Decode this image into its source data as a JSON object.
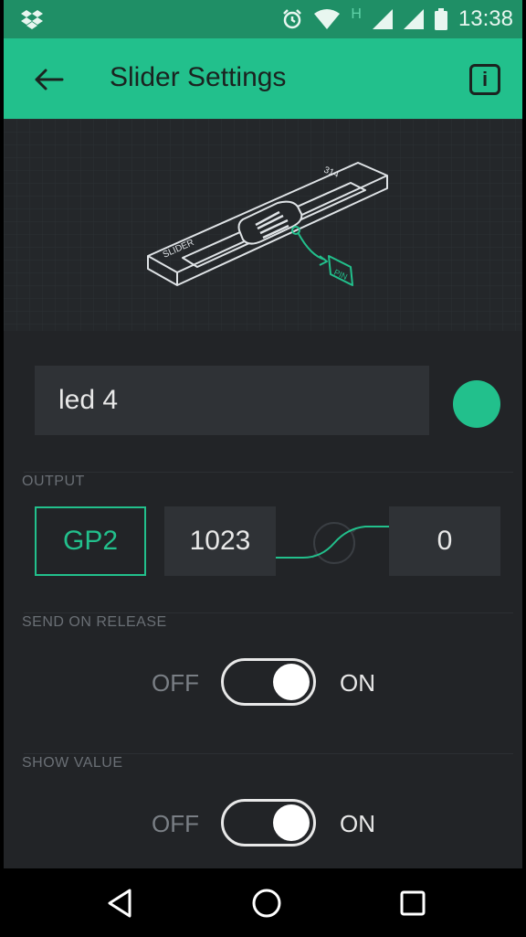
{
  "status_bar": {
    "time": "13:38",
    "network_letter": "H",
    "icons": [
      "dropbox-icon",
      "alarm-icon",
      "wifi-icon",
      "signal-icon",
      "signal-icon",
      "battery-icon"
    ]
  },
  "app_bar": {
    "title": "Slider Settings",
    "back_icon": "arrow-left-icon",
    "info_label": "i"
  },
  "illustration": {
    "slider_label": "SLIDER",
    "value_label": "314",
    "pin_label": "PIN"
  },
  "name_input": {
    "value": "led 4"
  },
  "color": {
    "accent": "#22c08c"
  },
  "output": {
    "section_label": "OUTPUT",
    "pin": "GP2",
    "max_value": "1023",
    "min_value": "0"
  },
  "send_on_release": {
    "section_label": "SEND ON RELEASE",
    "off_label": "OFF",
    "on_label": "ON",
    "state": "on"
  },
  "show_value": {
    "section_label": "SHOW VALUE",
    "off_label": "OFF",
    "on_label": "ON",
    "state": "on"
  },
  "nav_bar": {
    "icons": [
      "back-triangle-icon",
      "home-circle-icon",
      "recents-square-icon"
    ]
  }
}
